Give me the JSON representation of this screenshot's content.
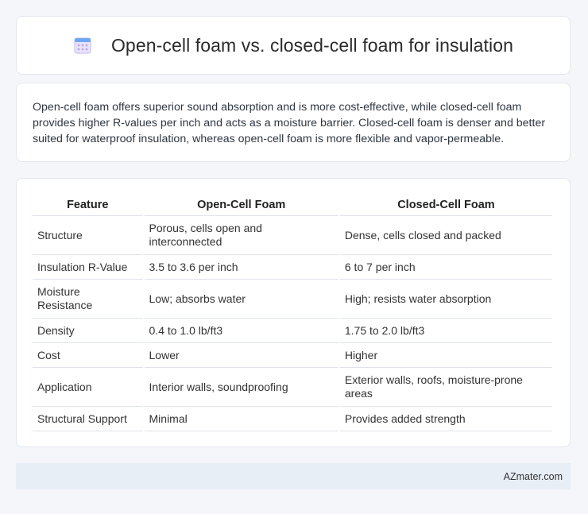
{
  "header": {
    "title": "Open-cell foam vs. closed-cell foam for insulation",
    "icon": "calendar-icon"
  },
  "summary": {
    "text": "Open-cell foam offers superior sound absorption and is more cost-effective, while closed-cell foam provides higher R-values per inch and acts as a moisture barrier. Closed-cell foam is denser and better suited for waterproof insulation, whereas open-cell foam is more flexible and vapor-permeable."
  },
  "table": {
    "headers": [
      "Feature",
      "Open-Cell Foam",
      "Closed-Cell Foam"
    ],
    "rows": [
      [
        "Structure",
        "Porous, cells open and interconnected",
        "Dense, cells closed and packed"
      ],
      [
        "Insulation R-Value",
        "3.5 to 3.6 per inch",
        "6 to 7 per inch"
      ],
      [
        "Moisture Resistance",
        "Low; absorbs water",
        "High; resists water absorption"
      ],
      [
        "Density",
        "0.4 to 1.0 lb/ft3",
        "1.75 to 2.0 lb/ft3"
      ],
      [
        "Cost",
        "Lower",
        "Higher"
      ],
      [
        "Application",
        "Interior walls, soundproofing",
        "Exterior walls, roofs, moisture-prone areas"
      ],
      [
        "Structural Support",
        "Minimal",
        "Provides added strength"
      ]
    ]
  },
  "footer": {
    "brand": "AZmater.com"
  },
  "colors": {
    "background": "#f4f6f9",
    "card": "#ffffff",
    "footer": "#e8eef6",
    "icon_accent": "#b9a6e6"
  }
}
